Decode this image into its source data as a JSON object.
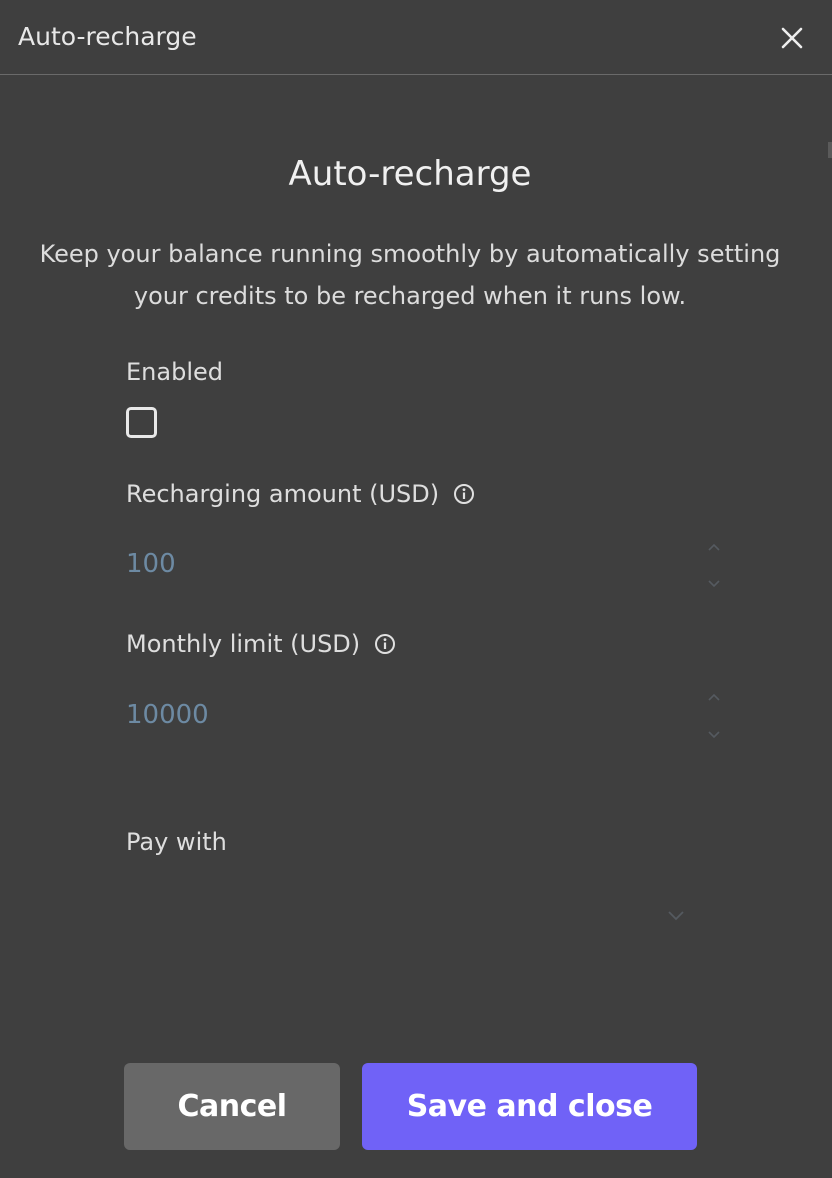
{
  "window": {
    "title": "Auto-recharge",
    "close_icon": "close-icon"
  },
  "dialog": {
    "title": "Auto-recharge",
    "description": "Keep your balance running smoothly by automatically setting your credits to be recharged when it runs low."
  },
  "enabled": {
    "label": "Enabled",
    "checked": false
  },
  "recharging_amount": {
    "label": "Recharging amount (USD)",
    "value": "100",
    "info_icon": "info-icon"
  },
  "monthly_limit": {
    "label": "Monthly limit (USD)",
    "value": "10000",
    "info_icon": "info-icon"
  },
  "pay_with": {
    "label": "Pay with",
    "selected": ""
  },
  "buttons": {
    "cancel_label": "Cancel",
    "save_label": "Save and close"
  },
  "colors": {
    "background": "#3f3f3f",
    "value_text": "#6d8aa3",
    "primary_button": "#7062f7",
    "secondary_button": "#686868"
  }
}
